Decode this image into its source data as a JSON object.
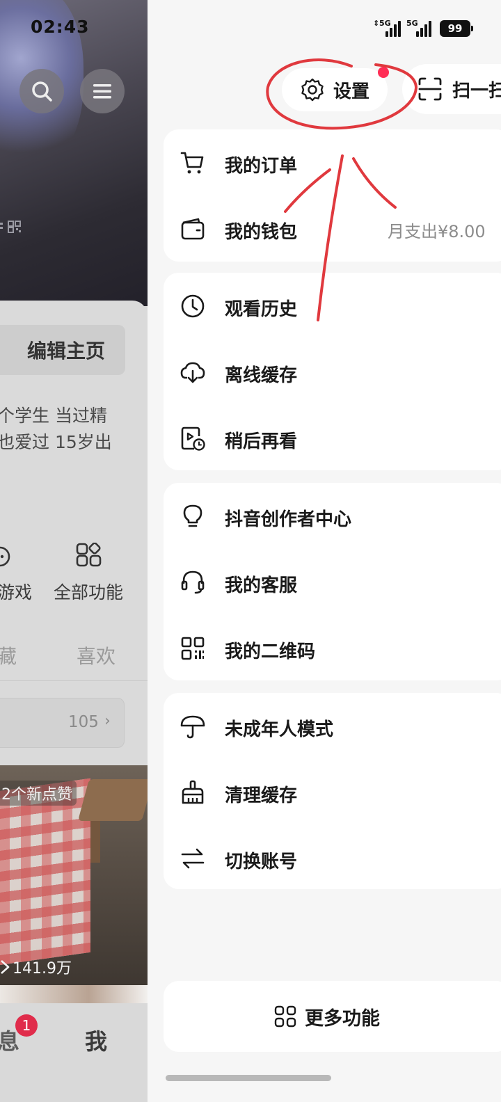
{
  "status_bar": {
    "time": "02:43",
    "sim1_label": "5G",
    "sim2_label": "5G",
    "battery": "99"
  },
  "left_page": {
    "edit_profile": "编辑主页",
    "bio_line1": "个学生 当过精",
    "bio_line2": "也爱过 15岁出",
    "shortcut_game": "游戏",
    "shortcut_all": "全部功能",
    "tab_collect": "藏",
    "tab_like": "喜欢",
    "collection_count": "105",
    "new_likes": "2个新点赞",
    "views": "141.9万",
    "nav_message": "息",
    "nav_message_badge": "1",
    "nav_me": "我"
  },
  "drawer": {
    "settings_label": "设置",
    "scan_label": "扫一扫",
    "group1": [
      {
        "label": "我的订单",
        "icon": "cart-icon"
      },
      {
        "label": "我的钱包",
        "icon": "wallet-icon",
        "value": "月支出¥8.00"
      }
    ],
    "group2": [
      {
        "label": "观看历史",
        "icon": "clock-icon"
      },
      {
        "label": "离线缓存",
        "icon": "cloud-download-icon"
      },
      {
        "label": "稍后再看",
        "icon": "watch-later-icon"
      }
    ],
    "group3": [
      {
        "label": "抖音创作者中心",
        "icon": "lightbulb-icon"
      },
      {
        "label": "我的客服",
        "icon": "headset-icon"
      },
      {
        "label": "我的二维码",
        "icon": "qr-code-icon"
      }
    ],
    "group4": [
      {
        "label": "未成年人模式",
        "icon": "umbrella-icon"
      },
      {
        "label": "清理缓存",
        "icon": "broom-icon"
      },
      {
        "label": "切换账号",
        "icon": "switch-arrows-icon"
      }
    ],
    "more_functions": "更多功能"
  },
  "colors": {
    "accent_red": "#ff2d55",
    "annotation_red": "#e0393e",
    "badge_red": "#e02c4b"
  }
}
